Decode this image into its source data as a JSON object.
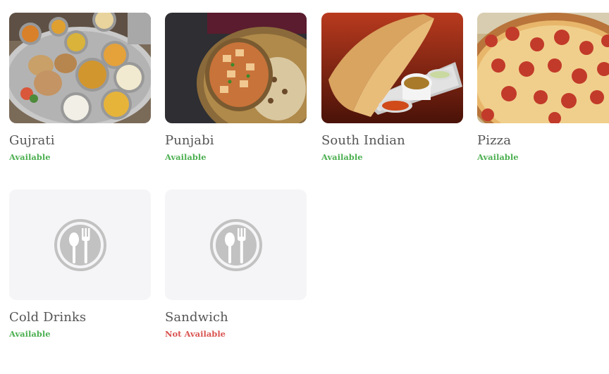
{
  "colors": {
    "available": "#4caf50",
    "not_available": "#d9534f",
    "placeholder_bg": "#f5f5f7"
  },
  "categories": [
    {
      "name": "Gujrati",
      "status": "Available",
      "image": "gujarati-thali-photo"
    },
    {
      "name": "Punjabi",
      "status": "Available",
      "image": "paneer-curry-photo"
    },
    {
      "name": "South Indian",
      "status": "Available",
      "image": "masala-dosa-photo"
    },
    {
      "name": "Pizza",
      "status": "Available",
      "image": "pepperoni-pizza-photo"
    },
    {
      "name": "Cold Drinks",
      "status": "Available",
      "image": "fork-spoon-icon"
    },
    {
      "name": "Sandwich",
      "status": "Not Available",
      "image": "fork-spoon-icon"
    }
  ]
}
